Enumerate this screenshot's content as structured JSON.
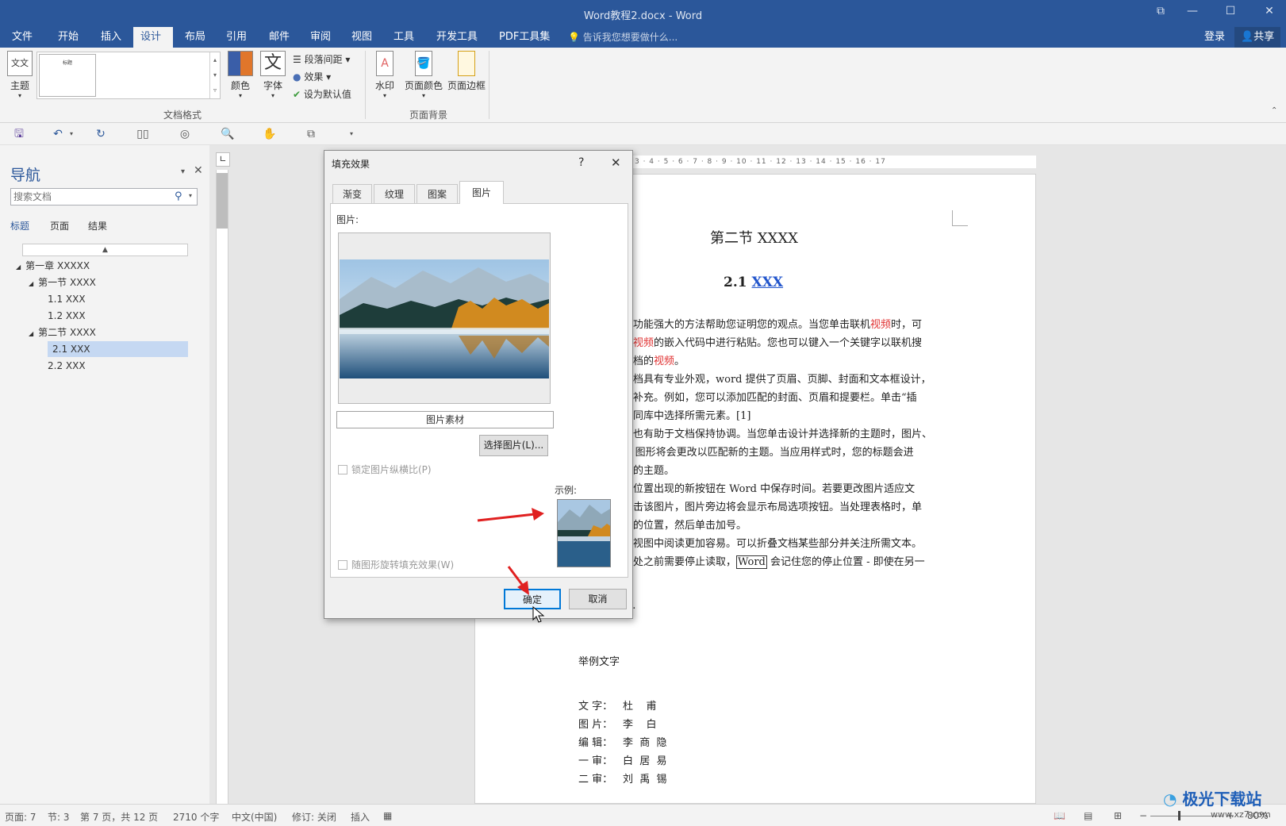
{
  "window": {
    "title": "Word教程2.docx - Word"
  },
  "ribbon_tabs": [
    "文件",
    "开始",
    "插入",
    "设计",
    "布局",
    "引用",
    "邮件",
    "审阅",
    "视图",
    "工具",
    "开发工具",
    "PDF工具集"
  ],
  "active_tab": "设计",
  "tell_me": "告诉我您想要做什么...",
  "account": {
    "login": "登录",
    "share": "共享"
  },
  "ribbon": {
    "theme": "主题",
    "colors": "颜色",
    "fonts": "字体",
    "paragraph_spacing": "段落间距",
    "effects": "效果",
    "set_default": "设为默认值",
    "watermark": "水印",
    "page_color": "页面颜色",
    "page_borders": "页面边框",
    "group_doc_format": "文档格式",
    "group_page_bg": "页面背景",
    "gallery_item": "标题"
  },
  "nav": {
    "title": "导航",
    "search_placeholder": "搜索文档",
    "tabs": [
      "标题",
      "页面",
      "结果"
    ],
    "tree": [
      {
        "label": "第一章 XXXXX",
        "level": 0,
        "expander": "◢"
      },
      {
        "label": "第一节 XXXX",
        "level": 1,
        "expander": "◢"
      },
      {
        "label": "1.1 XXX",
        "level": 2
      },
      {
        "label": "1.2 XXX",
        "level": 2
      },
      {
        "label": "第二节 XXXX",
        "level": 1,
        "expander": "◢"
      },
      {
        "label": "2.1 XXX",
        "level": 2,
        "selected": true
      },
      {
        "label": "2.2 XXX",
        "level": 2
      }
    ]
  },
  "ruler": {
    "marks": "3 · 4 · 5 · 6 · 7 · 8 · 9 · 10 · 11 · 12 · 13 · 14 · 15 · 16 · 17"
  },
  "document": {
    "section_title": "第二节  XXXX",
    "heading_num": "2.1",
    "heading_link": "XXX",
    "lines": [
      [
        "了功能强大的方法帮助您证明您的观点。当您单击联机",
        "视频",
        "时，可"
      ],
      [
        "的",
        "视频",
        "的嵌入代码中进行粘贴。您也可以键入一个关键字以联机搜"
      ],
      [
        "文档的",
        "视频",
        "。"
      ],
      [
        "文档具有专业外观，word 提供了页眉、页脚、封面和文本框设计，"
      ],
      [
        "为补充。例如，您可以添加匹配的封面、页眉和提要栏。单击“插"
      ],
      [
        "不同库中选择所需元素。[1]"
      ],
      [
        "式也有助于文档保持协调。当您单击设计并选择新的主题时，图片、"
      ],
      [
        "rt 图形将会更改以匹配新的主题。当应用样式时，您的标题会进"
      ],
      [
        "新的主题。"
      ],
      [
        "要位置出现的新按钮在 Word 中保存时间。若要更改图片适应文"
      ],
      [
        "单击该图片，图片旁边将会显示布局选项按钮。当处理表格时，单"
      ],
      [
        "列的位置，然后单击加号。"
      ],
      [
        "读视图中阅读更加容易。可以折叠文档某些部分并关注所需文本。"
      ],
      [
        "尾处之前需要停止读取，",
        "Word",
        " 会记住您的停止位置 - 即使在另一"
      ]
    ],
    "ellipsis": "...",
    "example_title": "举例文字",
    "credits": [
      {
        "role": "文  字：",
        "name": "杜    甫"
      },
      {
        "role": "图  片：",
        "name": "李    白"
      },
      {
        "role": "编  辑：",
        "name": "李  商  隐"
      },
      {
        "role": "一  审：",
        "name": "白  居  易"
      },
      {
        "role": "二  审：",
        "name": "刘  禹  锡"
      }
    ]
  },
  "dialog": {
    "title": "填充效果",
    "help": "?",
    "close": "✕",
    "tabs": [
      "渐变",
      "纹理",
      "图案",
      "图片"
    ],
    "active_tab": "图片",
    "picture_label": "图片:",
    "picture_name": "图片素材",
    "select_button": "选择图片(L)...",
    "lock_aspect": "锁定图片纵横比(P)",
    "rotate_with_shape": "随图形旋转填充效果(W)",
    "sample_label": "示例:",
    "ok": "确定",
    "cancel": "取消"
  },
  "status": {
    "page": "页面: 7",
    "section": "节: 3",
    "page_of": "第 7 页，共 12 页",
    "words": "2710 个字",
    "lang": "中文(中国)",
    "track": "修订: 关闭",
    "mode": "插入",
    "zoom": "80%"
  },
  "watermark_brand": "极光下载站",
  "watermark_url": "www.xz7.com",
  "colors": {
    "word_blue": "#2b579a",
    "nav_selected": "#c5d8f2",
    "ok_focus": "#0078d7",
    "link": "#2255cc",
    "red_text": "#e03030",
    "arrow_red": "#e02020"
  }
}
